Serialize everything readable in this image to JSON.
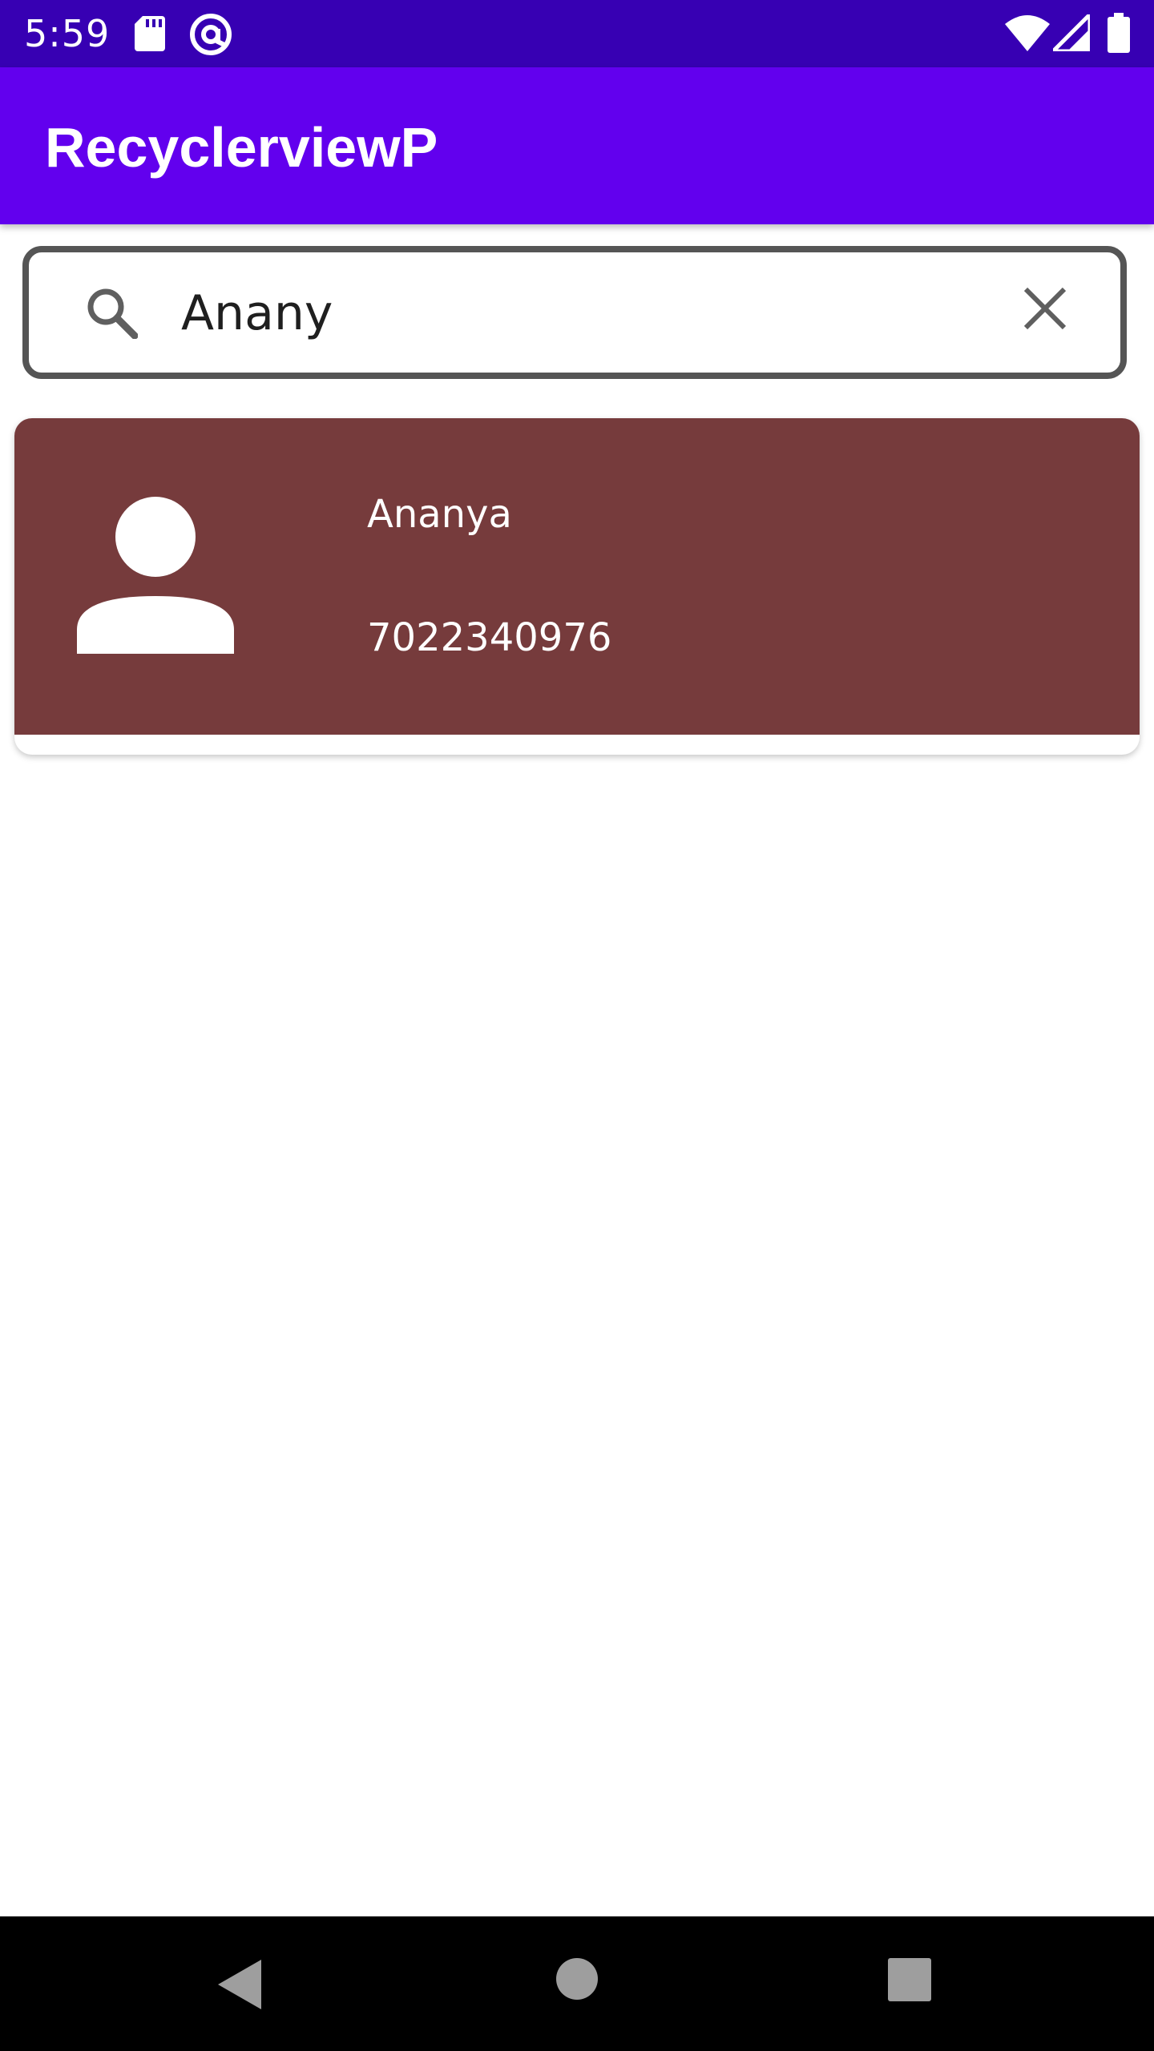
{
  "status_bar": {
    "time": "5:59",
    "icons": [
      "sd-card-icon",
      "at-sign-icon",
      "wifi-icon",
      "cellular-signal-icon",
      "battery-icon"
    ]
  },
  "app_bar": {
    "title": "RecyclerviewP",
    "color": "#6200ee"
  },
  "search": {
    "value": "Anany",
    "icons": [
      "search-icon",
      "clear-icon"
    ]
  },
  "contacts": [
    {
      "name": "Ananya",
      "phone": "7022340976",
      "icon": "person-icon",
      "card_color": "#763b3c"
    }
  ],
  "navigation": {
    "icons": [
      "back-icon",
      "home-icon",
      "recents-icon"
    ]
  }
}
